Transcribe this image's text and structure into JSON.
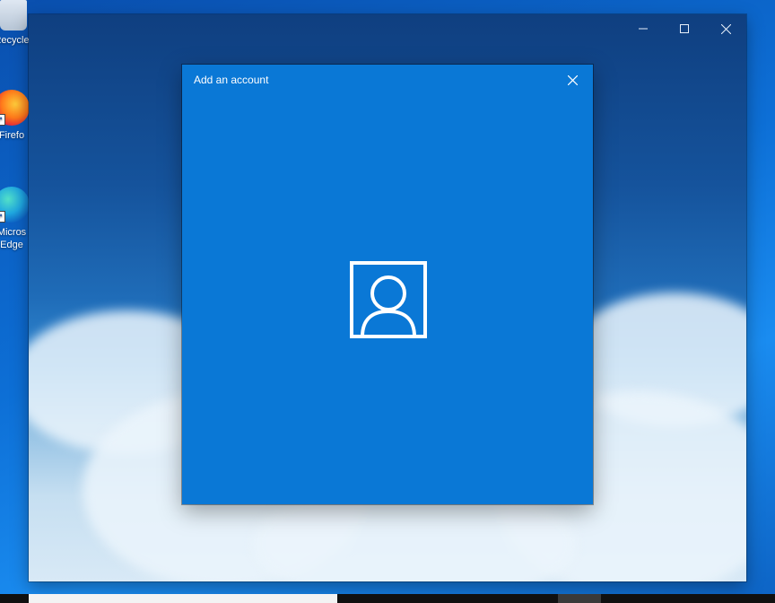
{
  "desktop": {
    "icons": [
      {
        "label": "Recycle",
        "icon": "recycle-bin-icon"
      },
      {
        "label": "Firefo",
        "icon": "firefox-icon"
      },
      {
        "label": "Micros Edge",
        "icon": "edge-icon"
      }
    ]
  },
  "window": {
    "caption_buttons": [
      "minimize",
      "maximize",
      "close"
    ]
  },
  "dialog": {
    "title": "Add an account",
    "close_icon": "close-icon",
    "center_icon": "account-icon",
    "background": "#0a78d6"
  },
  "colors": {
    "accent": "#0a78d6",
    "taskbar": "#101010"
  }
}
